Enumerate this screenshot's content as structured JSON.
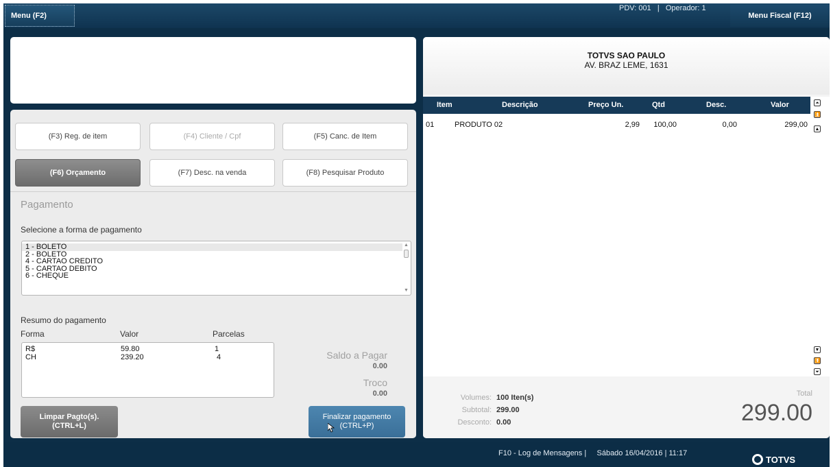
{
  "topbar": {
    "menu_label": "Menu (F2)",
    "pdv_info": "PDV: 001   |   Operador: 1",
    "fiscal_label": "Menu Fiscal (F12)"
  },
  "functions": {
    "f3": "(F3) Reg. de item",
    "f4": "(F4) Cliente / Cpf",
    "f5": "(F5) Canc. de Item",
    "f6": "(F6) Orçamento",
    "f7": "(F7) Desc. na venda",
    "f8": "(F8) Pesquisar Produto"
  },
  "payment": {
    "title": "Pagamento",
    "select_label": "Selecione a forma de pagamento",
    "options": [
      "1 - BOLETO",
      "2 - BOLETO",
      "4 - CARTAO CREDITO",
      "5 - CARTAO DEBITO",
      "6 - CHEQUE"
    ],
    "selected_index": 0,
    "resumo_label": "Resumo do pagamento",
    "col_forma": "Forma",
    "col_valor": "Valor",
    "col_parcelas": "Parcelas",
    "rows": [
      {
        "forma": "R$",
        "valor": "59.80",
        "parcelas": "1"
      },
      {
        "forma": "CH",
        "valor": "239.20",
        "parcelas": "4"
      }
    ],
    "saldo_label": "Saldo a Pagar",
    "saldo_value": "0.00",
    "troco_label": "Troco",
    "troco_value": "0.00",
    "limpar_line1": "Limpar Pagto(s).",
    "limpar_line2": "(CTRL+L)",
    "finalizar_line1": "Finalizar pagamento",
    "finalizar_line2": "(CTRL+P)"
  },
  "store": {
    "name": "TOTVS SAO PAULO",
    "address": "AV. BRAZ LEME, 1631"
  },
  "items_table": {
    "headers": {
      "item": "Item",
      "descricao": "Descrição",
      "preco": "Preço Un.",
      "qtd": "Qtd",
      "desc": "Desc.",
      "valor": "Valor"
    },
    "rows": [
      {
        "item": "01",
        "descricao": "PRODUTO 02",
        "preco": "2,99",
        "qtd": "100,00",
        "desc": "0,00",
        "valor": "299,00"
      }
    ]
  },
  "summary": {
    "volumes_label": "Volumes:",
    "volumes_value": "100 Iten(s)",
    "subtotal_label": "Subtotal:",
    "subtotal_value": "299.00",
    "desconto_label": "Desconto:",
    "desconto_value": "0.00",
    "total_label": "Total",
    "total_value": "299.00"
  },
  "statusbar": {
    "text": "F10 - Log de Mensagens |     Sábado 16/04/2016 | 11:17",
    "logo_text": "TOTVS"
  }
}
